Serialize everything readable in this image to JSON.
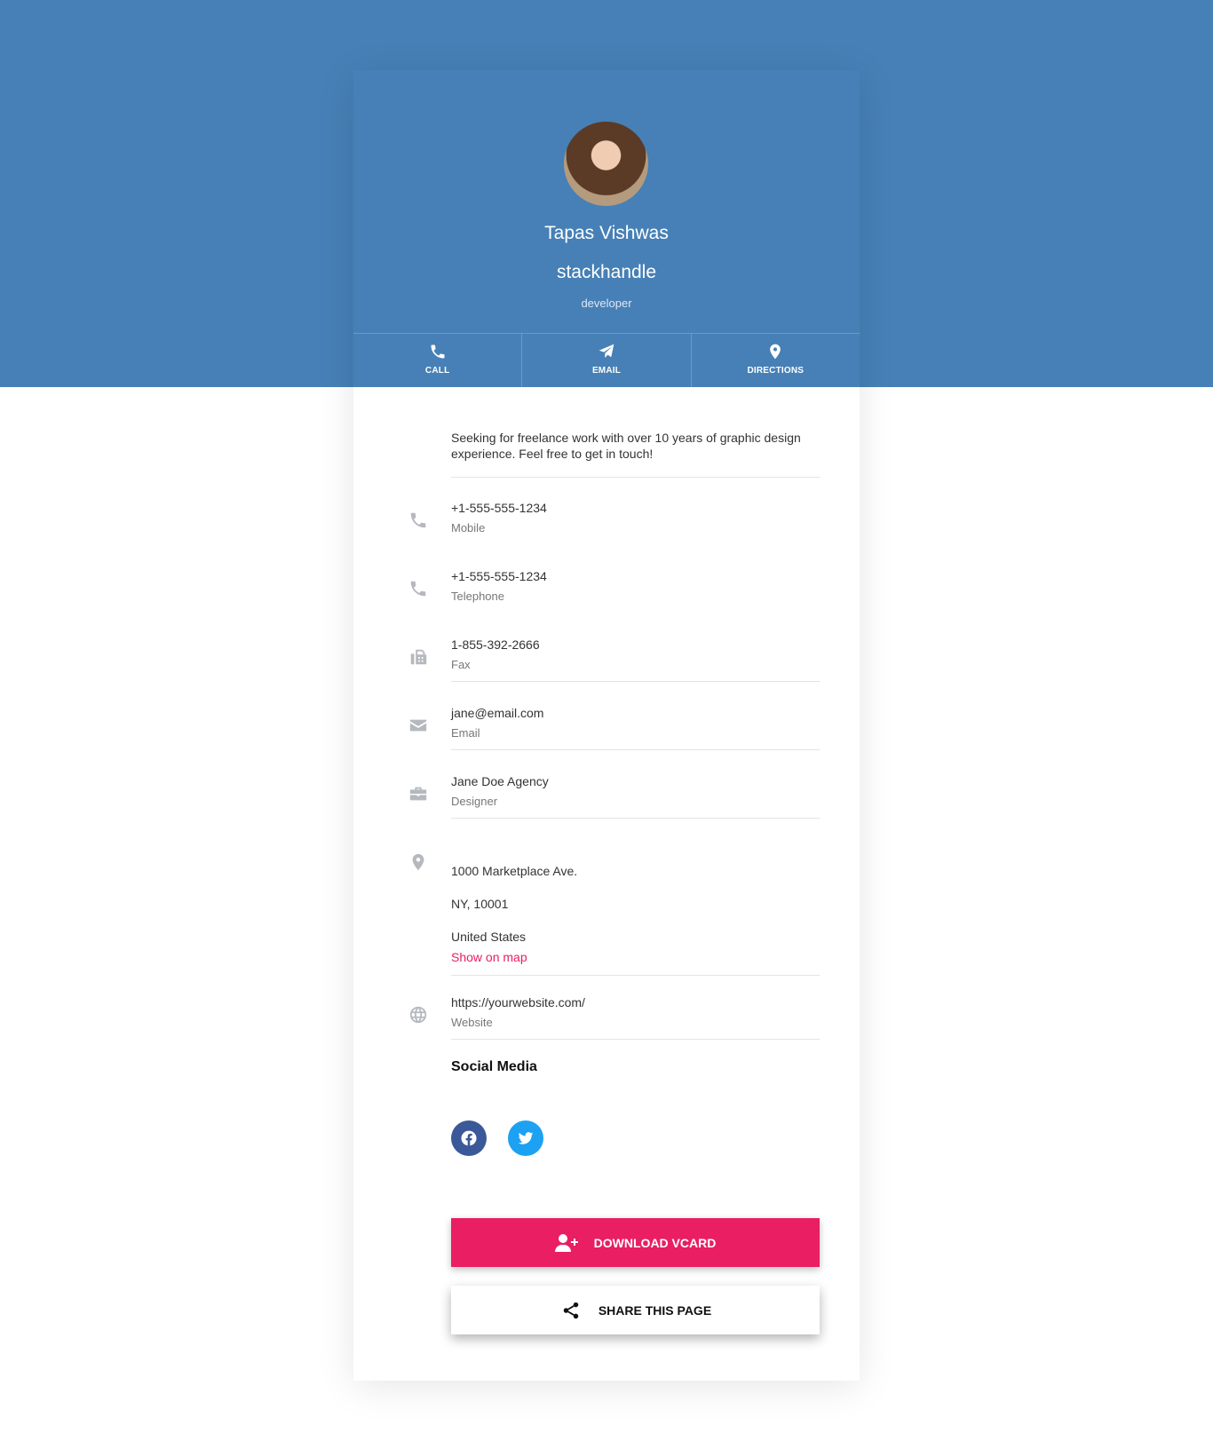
{
  "profile": {
    "name": "Tapas Vishwas",
    "company": "stackhandle",
    "role": "developer"
  },
  "actions": [
    {
      "label": "CALL",
      "icon": "phone-icon"
    },
    {
      "label": "EMAIL",
      "icon": "paper-plane-icon"
    },
    {
      "label": "DIRECTIONS",
      "icon": "map-marker-icon"
    }
  ],
  "bio": "Seeking for freelance work with over 10 years of graphic design experience. Feel free to get in touch!",
  "contacts": {
    "mobile": {
      "value": "+1-555-555-1234",
      "label": "Mobile"
    },
    "telephone": {
      "value": "+1-555-555-1234",
      "label": "Telephone"
    },
    "fax": {
      "value": "1-855-392-2666",
      "label": "Fax"
    },
    "email": {
      "value": "jane@email.com",
      "label": "Email"
    },
    "work": {
      "value": "Jane Doe Agency",
      "label": "Designer"
    },
    "address": {
      "line1": "1000 Marketplace Ave.",
      "line2": "NY, 10001",
      "line3": "United States",
      "map_link": "Show on map"
    },
    "website": {
      "value": "https://yourwebsite.com/",
      "label": "Website"
    }
  },
  "social": {
    "title": "Social Media",
    "facebook_color": "#3b5998",
    "twitter_color": "#1da1f2"
  },
  "buttons": {
    "download": "DOWNLOAD VCARD",
    "share": "SHARE THIS PAGE"
  },
  "colors": {
    "brand": "#4680b6",
    "accent": "#e91e63"
  }
}
